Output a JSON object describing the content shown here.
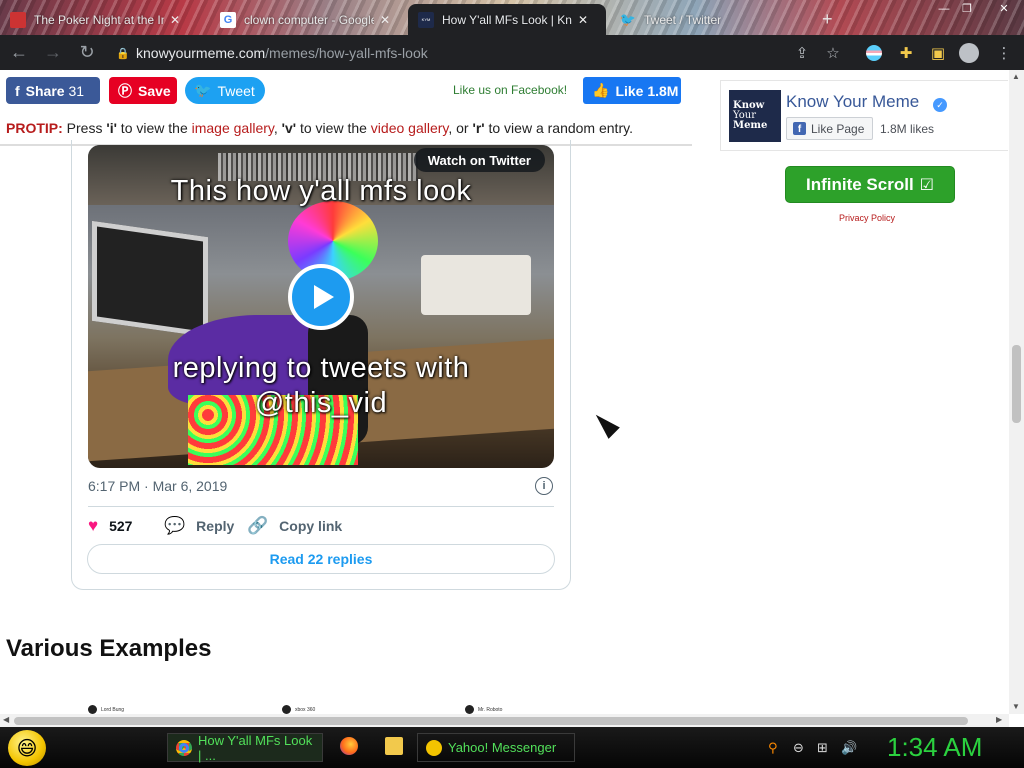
{
  "browser": {
    "tabs": [
      {
        "title": "The Poker Night at the Inventory",
        "favicon": "poker-favicon",
        "active": false
      },
      {
        "title": "clown computer - Google Search",
        "favicon": "google-favicon",
        "active": false
      },
      {
        "title": "How Y'all MFs Look | Know Your Meme",
        "favicon": "kym-favicon",
        "active": true
      },
      {
        "title": "Tweet / Twitter",
        "favicon": "twitter-favicon",
        "active": false
      }
    ],
    "new_tab": "+",
    "url_host": "knowyourmeme.com",
    "url_path": "/memes/how-yall-mfs-look"
  },
  "share_bar": {
    "fb_share": "Share",
    "fb_share_count": "31",
    "pin_save": "Save",
    "tweet": "Tweet",
    "like_us": "Like us on Facebook!",
    "fb_like": "Like",
    "fb_like_count": "1.8M"
  },
  "protip": {
    "label": "PROTIP:",
    "t1": " Press ",
    "k1": "'i'",
    "t2": " to view the ",
    "l1": "image gallery",
    "t3": ", ",
    "k2": "'v'",
    "t4": " to view the ",
    "l2": "video gallery",
    "t5": ", or ",
    "k3": "'r'",
    "t6": " to view a random entry."
  },
  "tweet": {
    "watch_on_twitter": "Watch on Twitter",
    "caption_top": "This how y'all mfs look",
    "caption_bottom_1": "replying to tweets with",
    "caption_bottom_2": "@this_vid",
    "timestamp": "6:17 PM · Mar 6, 2019",
    "likes": "527",
    "reply": "Reply",
    "copy_link": "Copy link",
    "read_replies": "Read 22 replies"
  },
  "section": {
    "various_examples": "Various Examples",
    "thumbs": [
      {
        "user": "Lord Bung"
      },
      {
        "user": "xbox 360"
      },
      {
        "user": "Mr. Roboto"
      }
    ]
  },
  "sidebar": {
    "logo_lines": [
      "Know",
      "Your",
      "Meme"
    ],
    "page_name": "Know Your Meme",
    "like_page": "Like Page",
    "likes": "1.8M likes",
    "infinite_scroll": "Infinite Scroll",
    "privacy_policy": "Privacy Policy"
  },
  "taskbar": {
    "chrome_task": "How Y'all MFs Look | ...",
    "yahoo_task": "Yahoo! Messenger",
    "clock": "1:34 AM"
  },
  "colors": {
    "accent_green": "#2da12a",
    "twitter_blue": "#1d9bf0",
    "fb_blue": "#3b5998",
    "pin_red": "#e60023",
    "protip_red": "#b71c1c"
  }
}
